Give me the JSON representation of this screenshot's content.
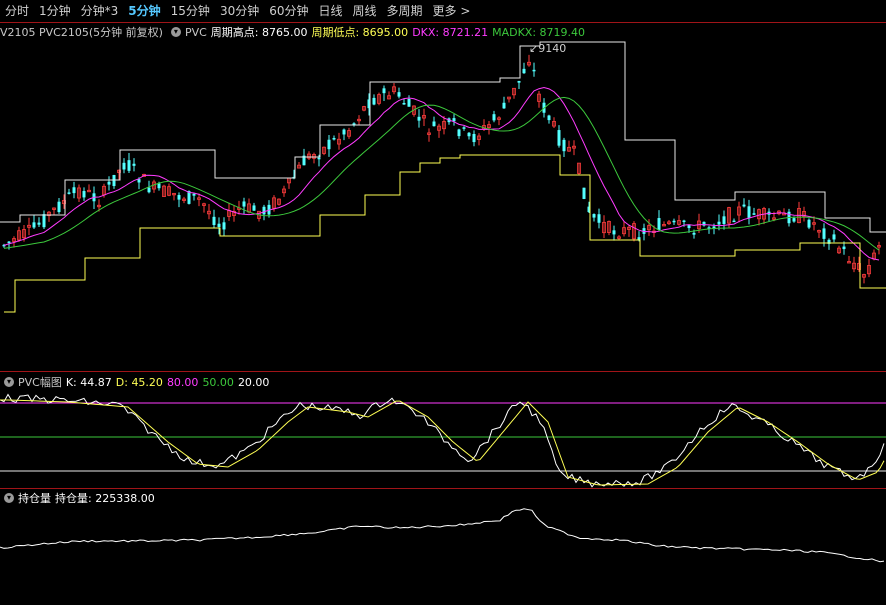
{
  "tabs": [
    "分时",
    "1分钟",
    "分钟*3",
    "5分钟",
    "15分钟",
    "30分钟",
    "60分钟",
    "日线",
    "周线",
    "多周期",
    "更多 >"
  ],
  "active_tab": "5分钟",
  "main_header": {
    "contract": "V2105 PVC2105(5分钟 前复权)",
    "symbol": "PVC",
    "high_label": "周期高点: 8765.00",
    "low_label": "周期低点: 8695.00",
    "dkx_label": "DKX: 8721.21",
    "madkx_label": "MADKX: 8719.40",
    "peak_label": "9140"
  },
  "osc_header": {
    "name": "PVC幅图",
    "k_label": "K: 44.87",
    "d_label": "D: 45.20",
    "l80": "80.00",
    "l50": "50.00",
    "l20": "20.00"
  },
  "oi_header": {
    "name": "持仓量",
    "value_label": "持仓量: 225338.00"
  },
  "colors": {
    "up": "#ff3c3c",
    "down": "#54ffff",
    "dkx": "#ff3cff",
    "madkx": "#3cc83c",
    "high": "#e8e8e8",
    "low": "#ffff55",
    "kline": "#ffffff",
    "dline": "#ffff55"
  }
}
